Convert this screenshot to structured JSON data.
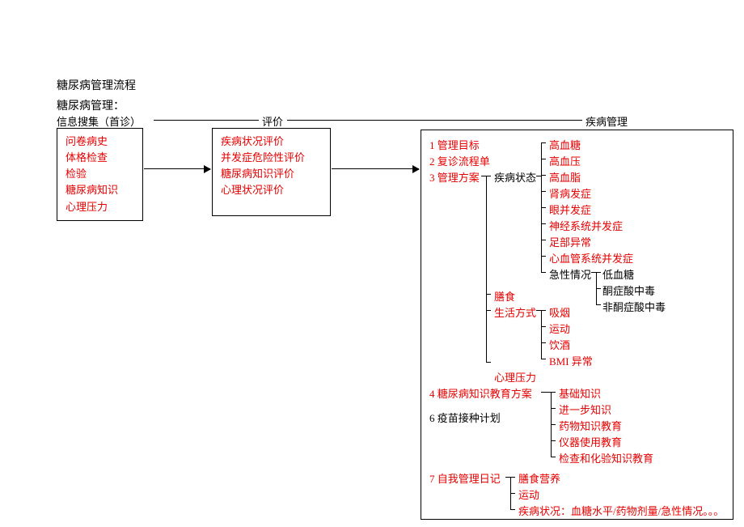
{
  "title": "糖尿病管理流程",
  "subtitle": "糖尿病管理：",
  "sections": {
    "collect": "信息搜集（首诊）",
    "eval": "评价",
    "manage": "疾病管理"
  },
  "box_collect": [
    "问卷病史",
    "体格检查",
    "检验",
    "糖尿病知识",
    "心理压力"
  ],
  "box_eval": [
    "疾病状况评价",
    "并发症危险性评价",
    "糖尿病知识评价",
    "心理状况评价"
  ],
  "mg": {
    "n1": "1 管理目标",
    "n2": "2 复诊流程单",
    "n3": "3 管理方案",
    "n3_state": "疾病状态",
    "state_list": [
      "高血糖",
      "高血压",
      "高血脂",
      "肾病发症",
      "眼并发症",
      "神经系统并发症",
      "足部异常",
      "心血管系统并发症"
    ],
    "acute_label": "急性情况",
    "acute_list": [
      "低血糖",
      "酮症酸中毒",
      "非酮症酸中毒"
    ],
    "diet": "膳食",
    "lifestyle": "生活方式",
    "lifestyle_list": [
      "吸烟",
      "运动",
      "饮酒",
      "BMI 异常"
    ],
    "psych": "心理压力",
    "n4": "4 糖尿病知识教育方案",
    "edu_list": [
      "基础知识",
      "进一步知识",
      "药物知识教育",
      "仪器使用教育",
      "检查和化验知识教育"
    ],
    "n6": "6 疫苗接种计划",
    "n7": "7 自我管理日记",
    "diary_list": [
      "膳食营养",
      "运动",
      "疾病状况：血糖水平/药物剂量/急性情况。。。"
    ]
  }
}
